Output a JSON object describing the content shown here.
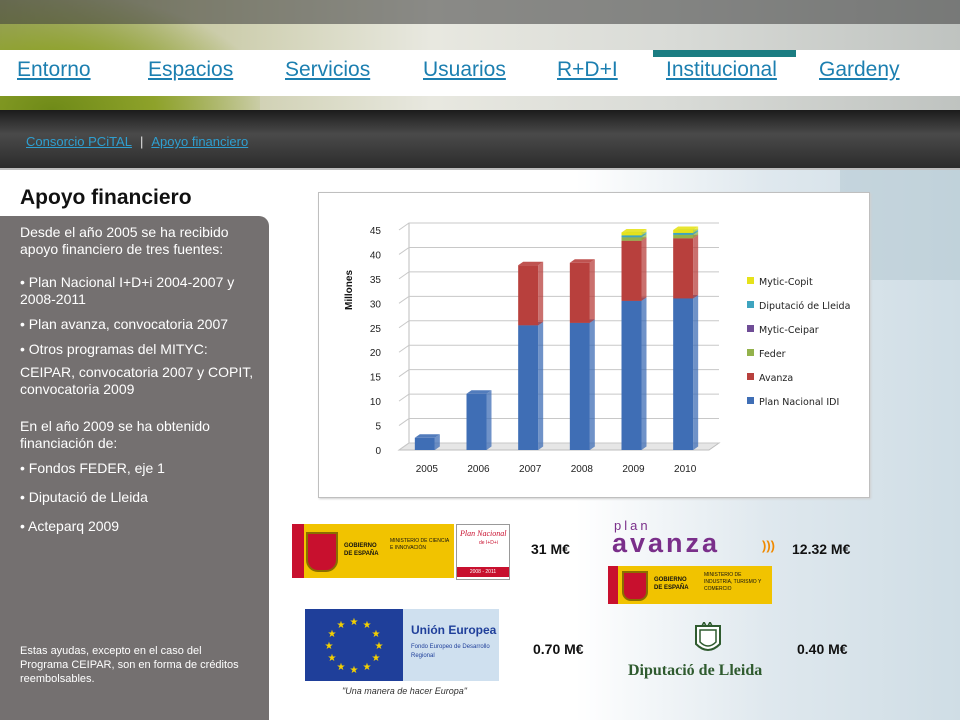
{
  "nav": {
    "items": [
      {
        "label": " Entorno"
      },
      {
        "label": "Espacios"
      },
      {
        "label": "Servicios"
      },
      {
        "label": "Usuarios"
      },
      {
        "label": "R+D+I"
      },
      {
        "label": "Institucional"
      },
      {
        "label": " Gardeny"
      }
    ],
    "active": "Institucional"
  },
  "breadcrumb": {
    "items": [
      {
        "label": "Consorcio PCiTAL"
      },
      {
        "label": "Apoyo financiero"
      }
    ],
    "separator": "|"
  },
  "page": {
    "title": "Apoyo financiero"
  },
  "side": {
    "intro": "Desde el año 2005  se ha recibido apoyo financiero de tres fuentes:",
    "bullets1": [
      "• Plan Nacional I+D+i 2004-2007 y 2008-2011",
      "• Plan avanza, convocatoria 2007",
      "• Otros programas del MITYC:"
    ],
    "others": "CEIPAR, convocatoria 2007 y COPIT, convocatoria 2009",
    "intro2": "En el año 2009 se ha obtenido financiación de:",
    "bullets2": [
      "• Fondos FEDER, eje 1",
      "• Diputació de Lleida",
      "• Acteparq 2009"
    ],
    "note": "Estas ayudas, excepto en el caso del Programa CEIPAR, son en forma de créditos reembolsables."
  },
  "chart_data": {
    "type": "bar",
    "stacked": true,
    "categories": [
      "2005",
      "2006",
      "2007",
      "2008",
      "2009",
      "2010"
    ],
    "ylabel": "Millones",
    "ylim": [
      0,
      45
    ],
    "yticks": [
      "0",
      "5",
      "10",
      "15",
      "20",
      "25",
      "30",
      "35",
      "40",
      "45"
    ],
    "grid": true,
    "legend_position": "right",
    "series": [
      {
        "name": "Plan Nacional IDI",
        "color": "#3f6eb5",
        "values": [
          2.5,
          11.5,
          25.5,
          26,
          30.5,
          31
        ]
      },
      {
        "name": "Avanza",
        "color": "#b8403d",
        "values": [
          0,
          0,
          12.3,
          12.3,
          12.3,
          12.3
        ]
      },
      {
        "name": "Feder",
        "color": "#93b24b",
        "values": [
          0,
          0,
          0,
          0,
          0.7,
          0.7
        ]
      },
      {
        "name": "Mytic-Ceipar",
        "color": "#6f4d96",
        "values": [
          0,
          0,
          0,
          0,
          0,
          0
        ]
      },
      {
        "name": "Diputació de Lleida",
        "color": "#3ea4bf",
        "values": [
          0,
          0,
          0,
          0,
          0.4,
          0.4
        ]
      },
      {
        "name": "Mytic-Copit",
        "color": "#e6e21a",
        "values": [
          0,
          0,
          0,
          0,
          0.6,
          0.6
        ]
      }
    ]
  },
  "logos": {
    "gobierno1": {
      "line1": "GOBIERNO",
      "line2": "DE ESPAÑA",
      "ministry": "MINISTERIO DE CIENCIA E INNOVACIÓN"
    },
    "plan_nacional": {
      "title": "Plan Nacional",
      "sub": "de I+D+i",
      "years": "2008 - 2011"
    },
    "plan_avanza": {
      "top": "plan",
      "word": "avanza",
      "dots": ")))"
    },
    "gobierno2": {
      "line1": "GOBIERNO",
      "line2": "DE ESPAÑA",
      "ministry": "MINISTERIO DE INDUSTRIA, TURISMO Y COMERCIO"
    },
    "ue": {
      "title": "Unión Europea",
      "sub": "Fondo Europeo de Desarrollo Regional",
      "motto": "\"Una manera de hacer Europa\""
    },
    "diputacio": {
      "name": "Diputació de Lleida"
    }
  },
  "amounts": {
    "plan_nacional": "31 M€",
    "avanza": "12.32 M€",
    "feder": "0.70 M€",
    "diputacio": "0.40 M€"
  },
  "colors": {
    "nav_link": "#1c7fb0",
    "active_bar": "#1b7d82",
    "panel": "#747070"
  }
}
